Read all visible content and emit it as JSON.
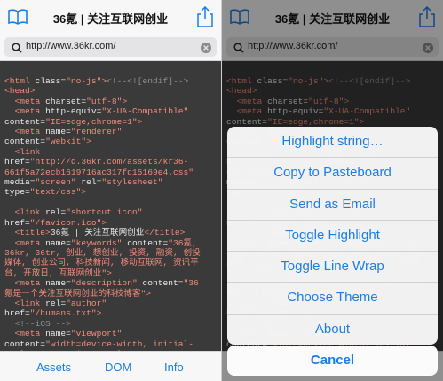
{
  "page_title": "36氪 | 关注互联网创业",
  "url": "http://www.36kr.com/",
  "icons": {
    "bookmarks": "book-icon",
    "share": "share-icon",
    "search": "search-icon",
    "clear": "clear-icon"
  },
  "accent_color": "#1a7ee6",
  "code_lines": [
    [
      [
        "t",
        "<html "
      ],
      [
        "a",
        "class="
      ],
      [
        "v",
        "\"no-js\""
      ],
      [
        "t",
        ">"
      ],
      [
        "c",
        "<!--<![endif]-->"
      ]
    ],
    [
      [
        "t",
        "<head>"
      ]
    ],
    [
      [
        "t",
        "  <meta "
      ],
      [
        "a",
        "charset="
      ],
      [
        "v",
        "\"utf-8\""
      ],
      [
        "t",
        ">"
      ]
    ],
    [
      [
        "t",
        "  <meta "
      ],
      [
        "a",
        "http-equiv="
      ],
      [
        "v",
        "\"X-UA-Compatible\""
      ]
    ],
    [
      [
        "a",
        "content="
      ],
      [
        "v",
        "\"IE=edge,chrome=1\""
      ],
      [
        "t",
        ">"
      ]
    ],
    [
      [
        "t",
        "  <meta "
      ],
      [
        "a",
        "name="
      ],
      [
        "v",
        "\"renderer\""
      ]
    ],
    [
      [
        "a",
        "content="
      ],
      [
        "v",
        "\"webkit\""
      ],
      [
        "t",
        ">"
      ]
    ],
    [
      [
        "t",
        "  <link"
      ]
    ],
    [
      [
        "a",
        "href="
      ],
      [
        "v",
        "\"http://d.36kr.com/assets/kr36-"
      ]
    ],
    [
      [
        "v",
        "661f5a72ecb1619716ac317fd15169e4.css\""
      ]
    ],
    [
      [
        "a",
        "media="
      ],
      [
        "v",
        "\"screen\" "
      ],
      [
        "a",
        "rel="
      ],
      [
        "v",
        "\"stylesheet\""
      ]
    ],
    [
      [
        "a",
        "type="
      ],
      [
        "v",
        "\"text/css\""
      ],
      [
        "t",
        ">"
      ]
    ],
    [
      [
        "a",
        ""
      ]
    ],
    [
      [
        "t",
        "  <link "
      ],
      [
        "a",
        "rel="
      ],
      [
        "v",
        "\"shortcut icon\""
      ]
    ],
    [
      [
        "a",
        "href="
      ],
      [
        "v",
        "\"/favicon.ico\""
      ],
      [
        "t",
        ">"
      ]
    ],
    [
      [
        "t",
        "  <title>"
      ],
      [
        "a",
        "36氪 | 关注互联网创业"
      ],
      [
        "t",
        "</title>"
      ]
    ],
    [
      [
        "t",
        "  <meta "
      ],
      [
        "a",
        "name="
      ],
      [
        "v",
        "\"keywords\" "
      ],
      [
        "a",
        "content="
      ],
      [
        "v",
        "\"36氪,"
      ]
    ],
    [
      [
        "v",
        "36kr, 36tr, 创业, 想创业, 投资, 融资, 创投"
      ]
    ],
    [
      [
        "v",
        "媒体, 创业公司, 科技新闻, 移动互联网, 资讯平"
      ]
    ],
    [
      [
        "v",
        "台, 开放日, 互联网创业\""
      ],
      [
        "t",
        ">"
      ]
    ],
    [
      [
        "t",
        "  <meta "
      ],
      [
        "a",
        "name="
      ],
      [
        "v",
        "\"description\" "
      ],
      [
        "a",
        "content="
      ],
      [
        "v",
        "\"36"
      ]
    ],
    [
      [
        "v",
        "氪是一个关注互联网创业的科技博客\""
      ],
      [
        "t",
        ">"
      ]
    ],
    [
      [
        "t",
        "  <link "
      ],
      [
        "a",
        "rel="
      ],
      [
        "v",
        "\"author\""
      ]
    ],
    [
      [
        "a",
        "href="
      ],
      [
        "v",
        "\"/humans.txt\""
      ],
      [
        "t",
        ">"
      ]
    ],
    [
      [
        "c",
        "  <!--iOS -->"
      ]
    ],
    [
      [
        "t",
        "  <meta "
      ],
      [
        "a",
        "name="
      ],
      [
        "v",
        "\"viewport\""
      ]
    ],
    [
      [
        "a",
        "content="
      ],
      [
        "v",
        "\"width=device-width, initial-"
      ]
    ],
    [
      [
        "v",
        "scale=1.0, maximum-scale=1.0, user-"
      ]
    ]
  ],
  "tabs": [
    "Assets",
    "DOM",
    "Info"
  ],
  "action_sheet": {
    "items": [
      "Highlight string…",
      "Copy to Pasteboard",
      "Send as Email",
      "Toggle Highlight",
      "Toggle Line Wrap",
      "Choose Theme",
      "About"
    ],
    "cancel": "Cancel"
  }
}
